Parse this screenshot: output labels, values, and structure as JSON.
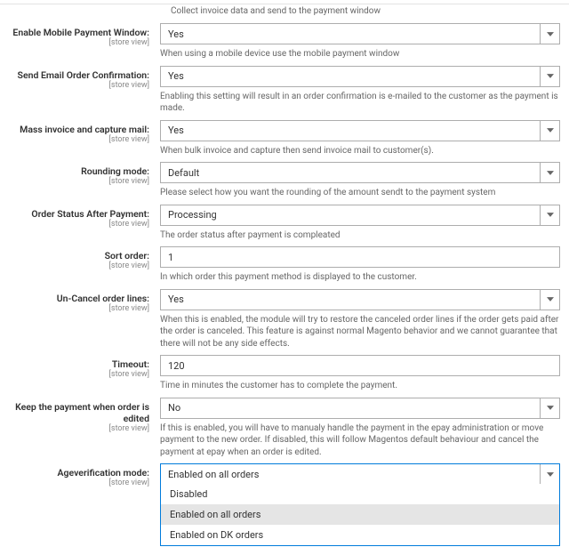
{
  "intro_hint": "Collect invoice data and send to the payment window",
  "scope_label": "[store view]",
  "fields": {
    "mobile_window": {
      "label": "Enable Mobile Payment Window:",
      "value": "Yes",
      "hint": "When using a mobile device use the mobile payment window"
    },
    "email_confirm": {
      "label": "Send Email Order Confirmation:",
      "value": "Yes",
      "hint": "Enabling this setting will result in an order confirmation is e-mailed to the customer as the payment is made."
    },
    "mass_invoice": {
      "label": "Mass invoice and capture mail:",
      "value": "Yes",
      "hint": "When bulk invoice and capture then send invoice mail to customer(s)."
    },
    "rounding": {
      "label": "Rounding mode:",
      "value": "Default",
      "hint": "Please select how you want the rounding of the amount sendt to the payment system"
    },
    "status_after": {
      "label": "Order Status After Payment:",
      "value": "Processing",
      "hint": "The order status after payment is compleated"
    },
    "sort_order": {
      "label": "Sort order:",
      "value": "1",
      "hint": "In which order this payment method is displayed to the customer."
    },
    "uncancel": {
      "label": "Un-Cancel order lines:",
      "value": "Yes",
      "hint": "When this is enabled, the module will try to restore the canceled order lines if the order gets paid after the order is canceled. This feature is against normal Magento behavior and we cannot guarantee that there will not be any side effects."
    },
    "timeout": {
      "label": "Timeout:",
      "value": "120",
      "hint": "Time in minutes the customer has to complete the payment."
    },
    "keep_payment": {
      "label": "Keep the payment when order is edited",
      "value": "No",
      "hint": "If this is enabled, you will have to manualy handle the payment in the epay administration or move payment to the new order. If disabled, this will follow Magentos default behaviour and cancel the payment at epay when an order is edited."
    },
    "ageverif": {
      "label": "Ageverification mode:",
      "value": "Enabled on all orders",
      "options": [
        "Disabled",
        "Enabled on all orders",
        "Enabled on DK orders"
      ],
      "highlighted": "Enabled on all orders"
    }
  }
}
